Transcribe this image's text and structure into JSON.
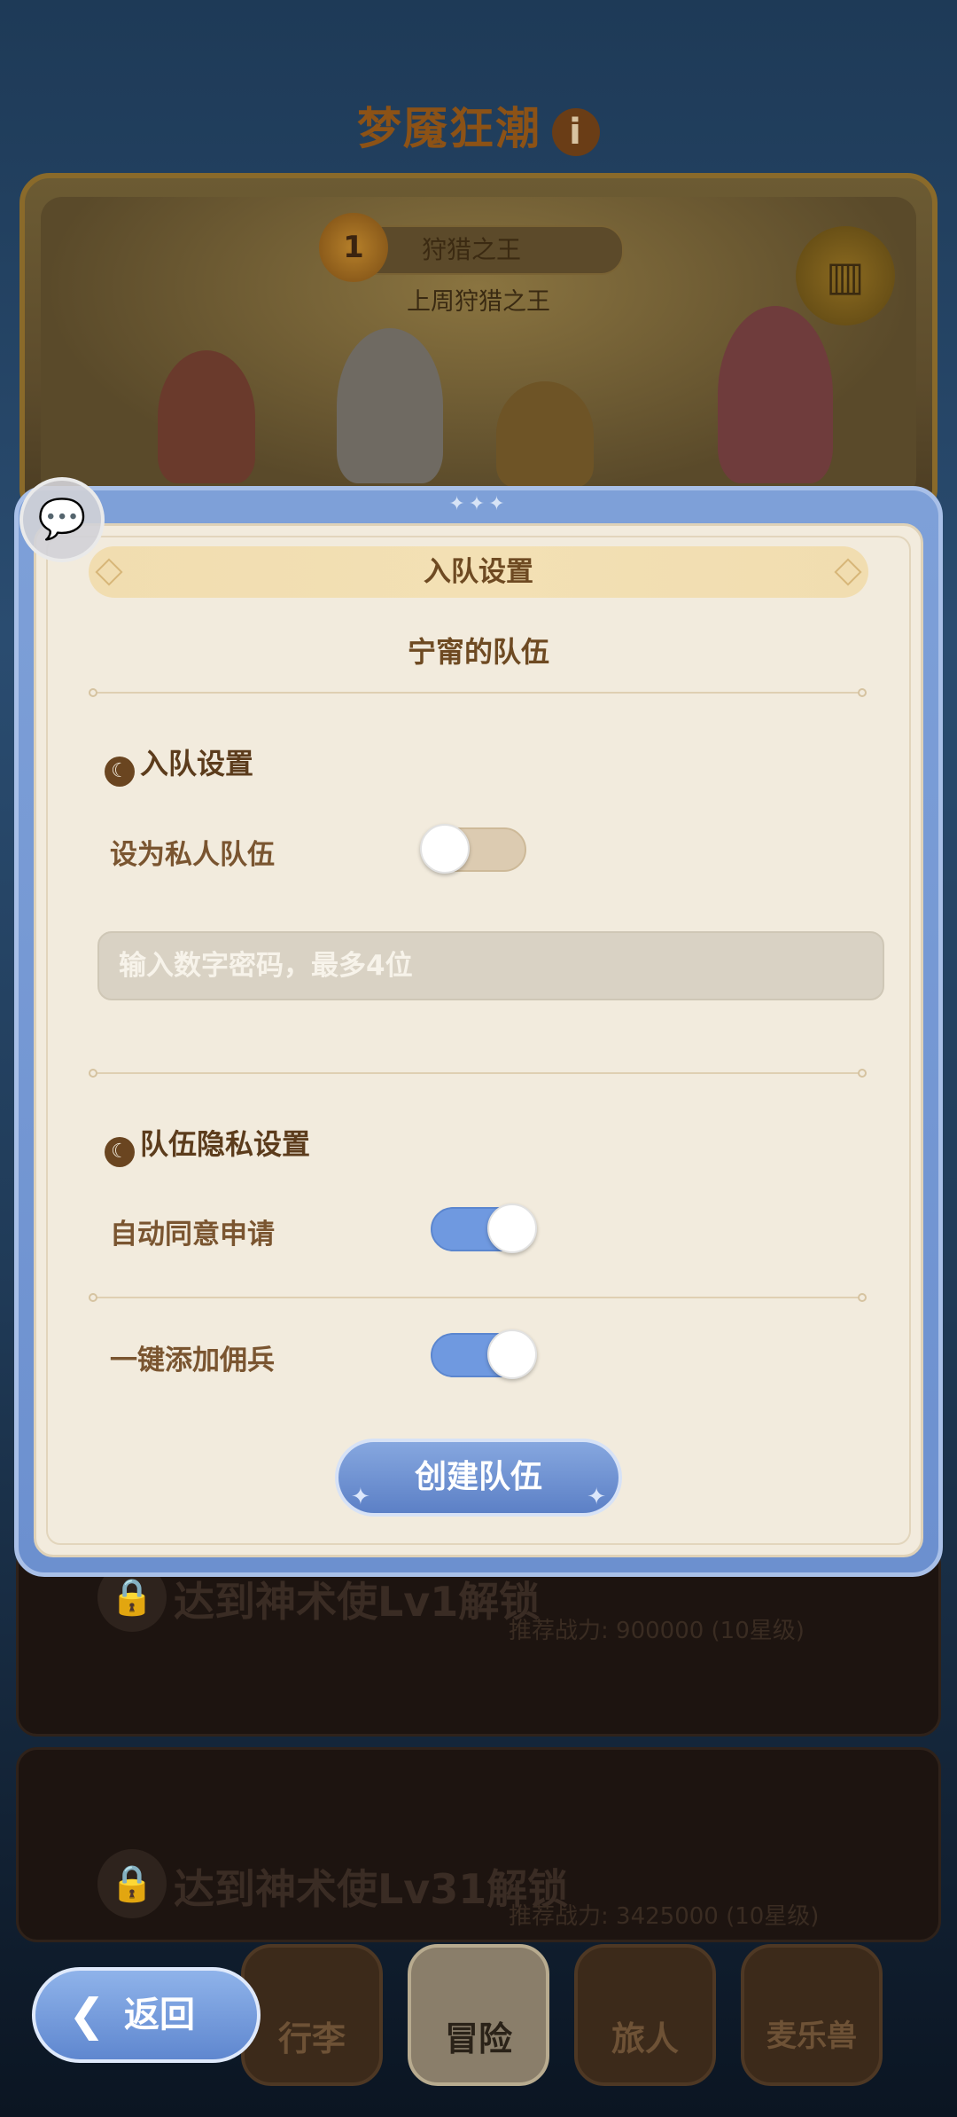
{
  "background": {
    "title": "梦魇狂潮",
    "info_icon": "i",
    "rank_number": "1",
    "rank_title": "狩猎之王",
    "rank_subtitle": "上周狩猎之王",
    "trophy_icon": "podium-icon",
    "locked_cards": [
      {
        "label": "达到神术使Lv1解锁",
        "sub": "推荐战力: 900000 (10星级)"
      },
      {
        "label": "达到神术使Lv31解锁",
        "sub": "推荐战力: 3425000 (10星级)"
      }
    ]
  },
  "bottom_nav": {
    "back_label": "返回",
    "tabs": [
      "行李",
      "冒险",
      "旅人",
      "麦乐兽"
    ],
    "active_tab": "冒险"
  },
  "modal": {
    "title": "入队设置",
    "team_name": "宁甯的队伍",
    "join_section": {
      "title": "入队设置",
      "private_label": "设为私人队伍",
      "private_on": false,
      "password_placeholder": "输入数字密码，最多4位"
    },
    "privacy_section": {
      "title": "队伍隐私设置",
      "auto_accept_label": "自动同意申请",
      "auto_accept_on": true,
      "add_mercenary_label": "一键添加佣兵",
      "add_mercenary_on": true
    },
    "create_button": "创建队伍"
  },
  "colors": {
    "modal_blue": "#6c90cf",
    "panel_cream": "#f2ebdd",
    "text_brown": "#6e4a22",
    "toggle_on": "#6f99e0"
  }
}
